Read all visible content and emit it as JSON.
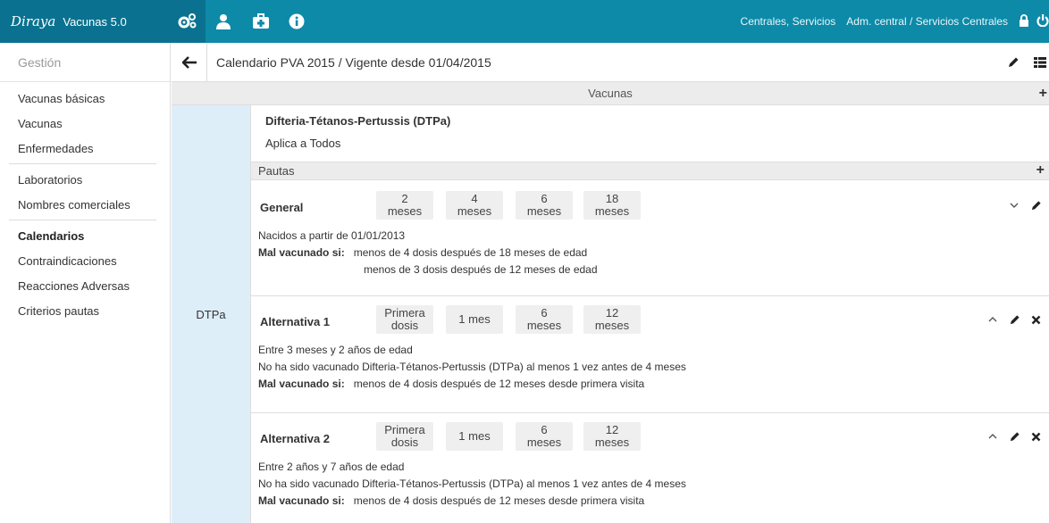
{
  "topbar": {
    "logo": "Diraya",
    "app_name": "Vacunas 5.0",
    "center": "Centrales, Servicios",
    "role": "Adm. central / Servicios Centrales"
  },
  "sidebar": {
    "title": "Gestión",
    "groups": [
      [
        "Vacunas básicas",
        "Vacunas",
        "Enfermedades"
      ],
      [
        "Laboratorios",
        "Nombres comerciales"
      ],
      [
        "Calendarios",
        "Contraindicaciones",
        "Reacciones Adversas",
        "Criterios pautas"
      ]
    ],
    "active": "Calendarios"
  },
  "header": {
    "title": "Calendario PVA 2015 / Vigente desde 01/04/2015"
  },
  "section": {
    "label": "Vacunas"
  },
  "vaccine": {
    "short": "DTPa",
    "name": "Difteria-Tétanos-Pertussis (DTPa)",
    "applies": "Aplica a Todos",
    "pautas_label": "Pautas",
    "pautas": [
      {
        "name": "General",
        "doses": [
          [
            "2",
            "meses"
          ],
          [
            "4",
            "meses"
          ],
          [
            "6",
            "meses"
          ],
          [
            "18",
            "meses"
          ]
        ],
        "conditions": [
          "Nacidos a partir de 01/01/2013"
        ],
        "bad_label": "Mal vacunado si:",
        "bad": [
          "menos de 4 dosis después de 18 meses de edad",
          "menos de 3 dosis después de 12 meses de edad"
        ],
        "expanded": false
      },
      {
        "name": "Alternativa 1",
        "doses": [
          [
            "Primera",
            "dosis"
          ],
          [
            "1 mes",
            ""
          ],
          [
            "6",
            "meses"
          ],
          [
            "12",
            "meses"
          ]
        ],
        "conditions": [
          "Entre 3 meses y 2 años de edad",
          "No ha sido vacunado Difteria-Tétanos-Pertussis (DTPa) al menos 1 vez antes de 4 meses"
        ],
        "bad_label": "Mal vacunado si:",
        "bad": [
          "menos de 4 dosis después de 12 meses desde primera visita"
        ],
        "expanded": true
      },
      {
        "name": "Alternativa 2",
        "doses": [
          [
            "Primera",
            "dosis"
          ],
          [
            "1 mes",
            ""
          ],
          [
            "6",
            "meses"
          ],
          [
            "12",
            "meses"
          ]
        ],
        "conditions": [
          "Entre 2 años y 7 años de edad",
          "No ha sido vacunado Difteria-Tétanos-Pertussis (DTPa) al menos 1 vez antes de 4 meses"
        ],
        "bad_label": "Mal vacunado si:",
        "bad": [
          "menos de 4 dosis después de 12 meses desde primera visita"
        ],
        "expanded": true
      }
    ]
  },
  "icons": {
    "cogs": "cogs-icon",
    "user": "user-icon",
    "medkit": "medkit-icon",
    "info": "info-icon",
    "lock": "lock-icon",
    "power": "power-icon",
    "back": "arrow-left-icon",
    "edit": "pencil-icon",
    "grid": "grid-icon",
    "add": "plus-icon"
  },
  "colors": {
    "topbar": "#0d8aa8",
    "topbar_dark": "#0a7290",
    "vaccine_label_bg": "#ddeef9"
  }
}
